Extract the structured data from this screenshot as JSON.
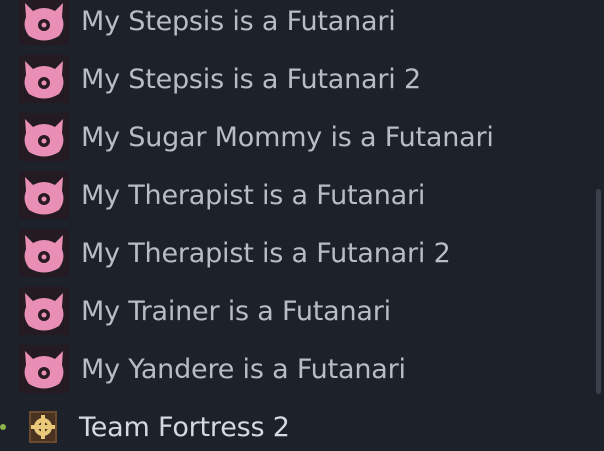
{
  "library": {
    "items": [
      {
        "label": "My Stepsis is a Futanari",
        "icon": "pink-demon-icon"
      },
      {
        "label": "My Stepsis is a Futanari 2",
        "icon": "pink-demon-icon"
      },
      {
        "label": "My Sugar Mommy is a Futanari",
        "icon": "pink-demon-icon"
      },
      {
        "label": "My Therapist is a Futanari",
        "icon": "pink-demon-icon"
      },
      {
        "label": "My Therapist is a Futanari 2",
        "icon": "pink-demon-icon"
      },
      {
        "label": "My Trainer is a Futanari",
        "icon": "pink-demon-icon"
      },
      {
        "label": "My Yandere is a Futanari",
        "icon": "pink-demon-icon"
      },
      {
        "label": "Team Fortress 2",
        "icon": "team-fortress-2-icon"
      }
    ]
  },
  "colors": {
    "background": "#1d2129",
    "icon_pink": "#e98fb6",
    "icon_dark": "#2a1a22",
    "tf2_brown": "#6b4a2e",
    "tf2_gold": "#e9c879",
    "running_green": "#8bb34a",
    "text_default": "#b8bcc4",
    "text_installed": "#d6dae0"
  }
}
